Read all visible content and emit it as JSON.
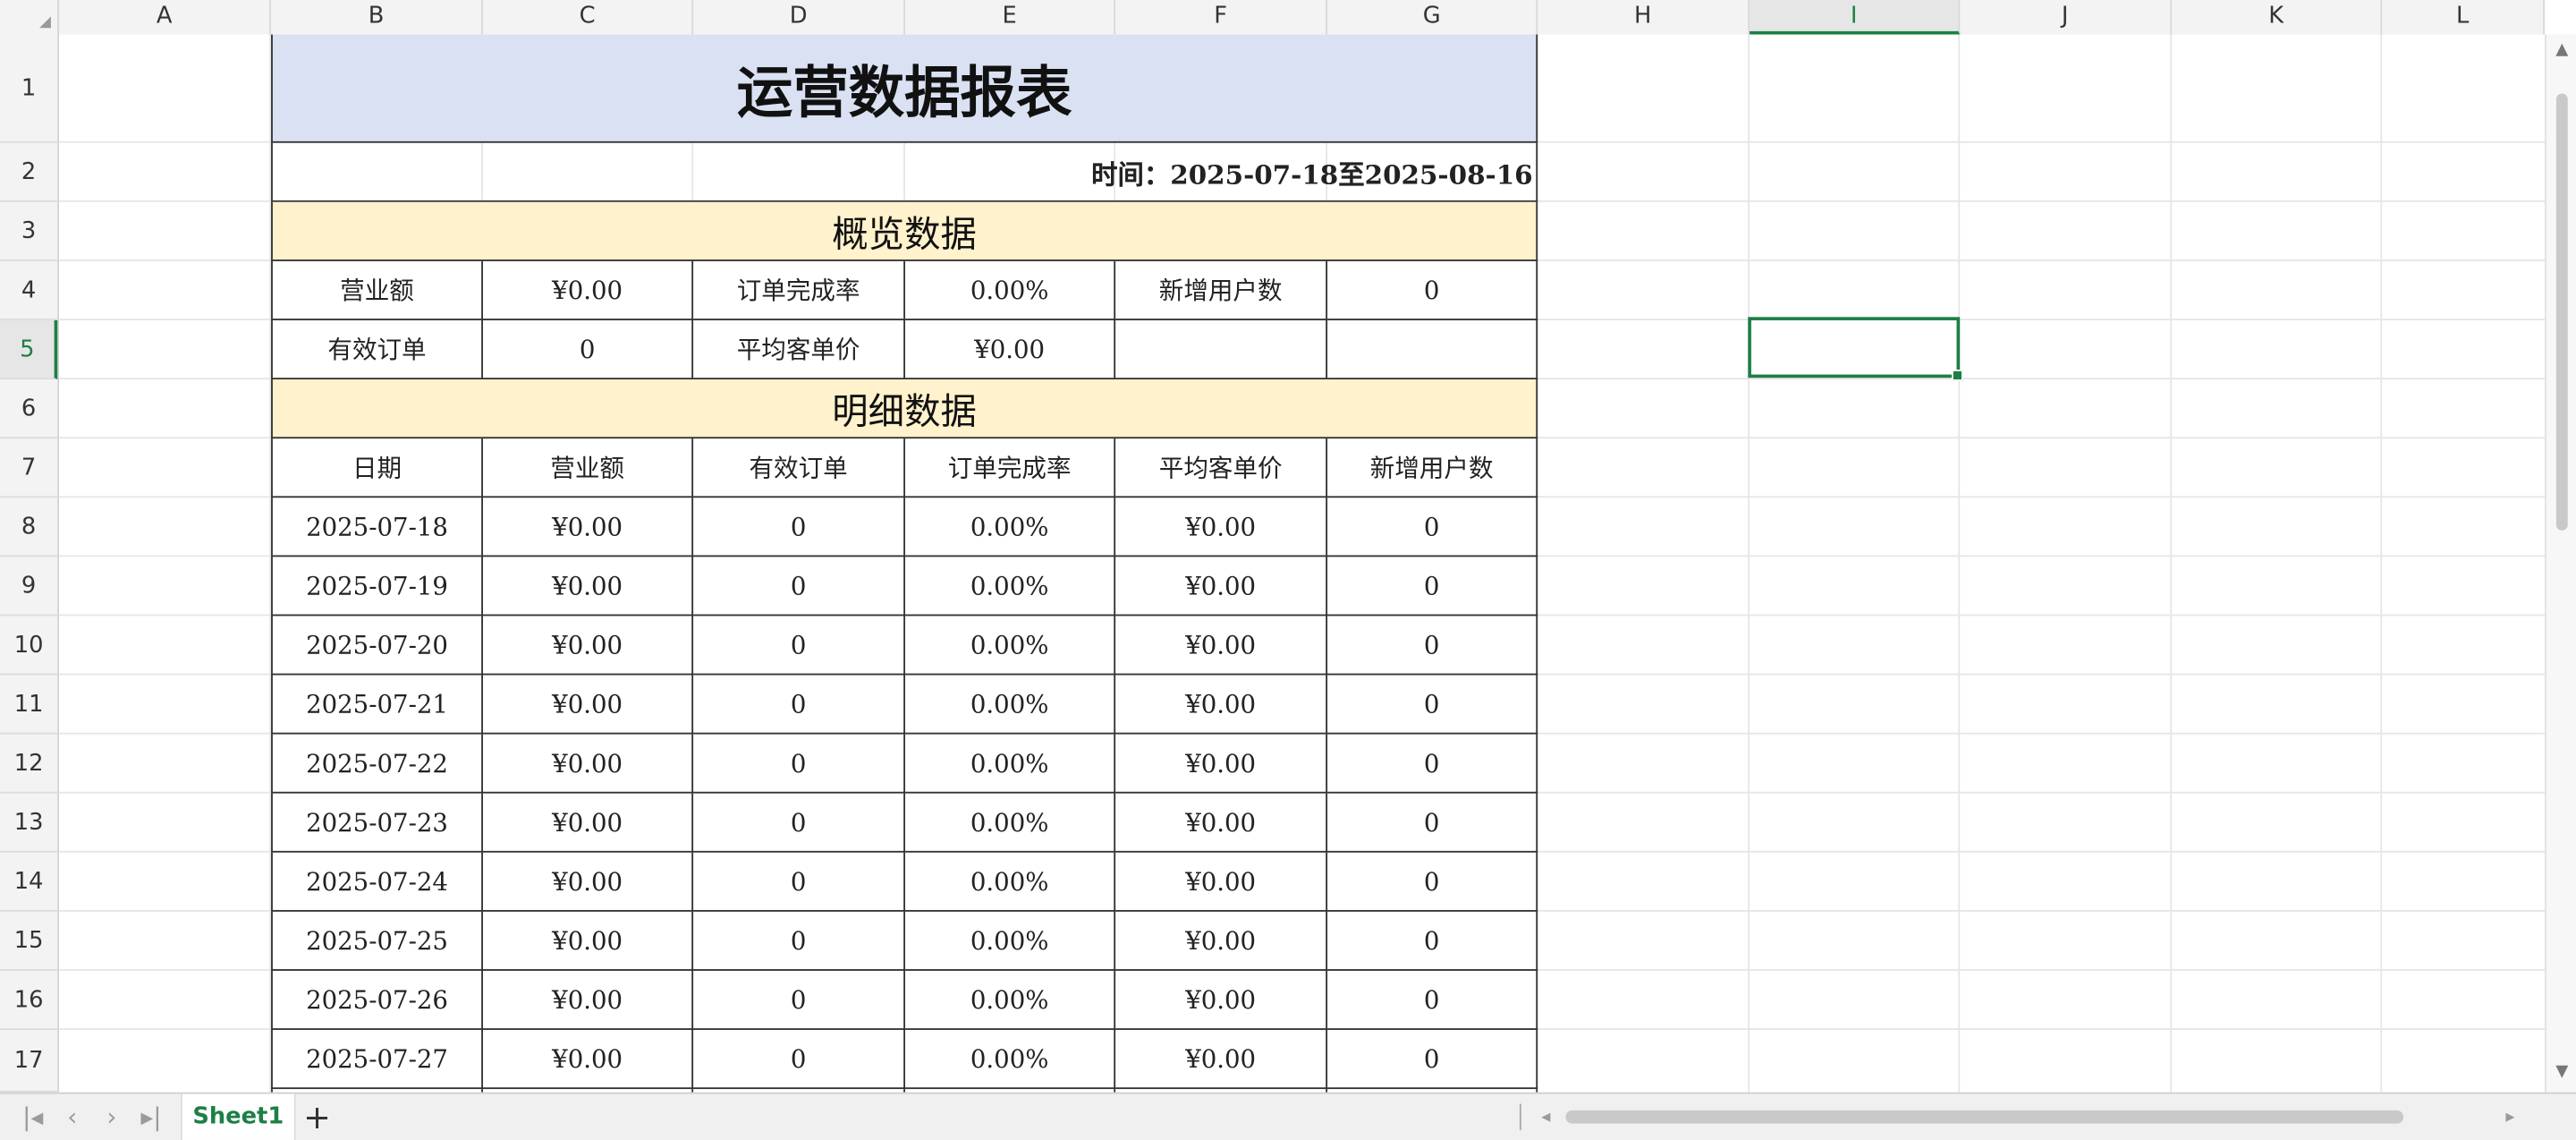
{
  "columns": [
    "A",
    "B",
    "C",
    "D",
    "E",
    "F",
    "G",
    "H",
    "I",
    "J",
    "K",
    "L"
  ],
  "rows": [
    "1",
    "2",
    "3",
    "4",
    "5",
    "6",
    "7",
    "8",
    "9",
    "10",
    "11",
    "12",
    "13",
    "14",
    "15",
    "16",
    "17"
  ],
  "selected": {
    "column": "I",
    "row": "5"
  },
  "report": {
    "title": "运营数据报表",
    "range": "时间：2025-07-18至2025-08-16",
    "overview_title": "概览数据",
    "overview_row1": [
      "营业额",
      "¥0.00",
      "订单完成率",
      "0.00%",
      "新增用户数",
      "0"
    ],
    "overview_row2": [
      "有效订单",
      "0",
      "平均客单价",
      "¥0.00",
      "",
      ""
    ],
    "detail_title": "明细数据",
    "detail_headers": [
      "日期",
      "营业额",
      "有效订单",
      "订单完成率",
      "平均客单价",
      "新增用户数"
    ],
    "detail_rows": [
      [
        "2025-07-18",
        "¥0.00",
        "0",
        "0.00%",
        "¥0.00",
        "0"
      ],
      [
        "2025-07-19",
        "¥0.00",
        "0",
        "0.00%",
        "¥0.00",
        "0"
      ],
      [
        "2025-07-20",
        "¥0.00",
        "0",
        "0.00%",
        "¥0.00",
        "0"
      ],
      [
        "2025-07-21",
        "¥0.00",
        "0",
        "0.00%",
        "¥0.00",
        "0"
      ],
      [
        "2025-07-22",
        "¥0.00",
        "0",
        "0.00%",
        "¥0.00",
        "0"
      ],
      [
        "2025-07-23",
        "¥0.00",
        "0",
        "0.00%",
        "¥0.00",
        "0"
      ],
      [
        "2025-07-24",
        "¥0.00",
        "0",
        "0.00%",
        "¥0.00",
        "0"
      ],
      [
        "2025-07-25",
        "¥0.00",
        "0",
        "0.00%",
        "¥0.00",
        "0"
      ],
      [
        "2025-07-26",
        "¥0.00",
        "0",
        "0.00%",
        "¥0.00",
        "0"
      ],
      [
        "2025-07-27",
        "¥0.00",
        "0",
        "0.00%",
        "¥0.00",
        "0"
      ]
    ]
  },
  "sheet_tab": "Sheet1",
  "add_sheet": "+",
  "nav": {
    "first": "|◂",
    "prev": "‹",
    "next": "›",
    "last": "▸|"
  },
  "scroll": {
    "up": "▲",
    "down": "▼",
    "left": "◂",
    "right": "▸"
  },
  "colors": {
    "accent": "#1d7f45",
    "title_fill": "#d9e1f2",
    "section_fill": "#fff2cc"
  }
}
